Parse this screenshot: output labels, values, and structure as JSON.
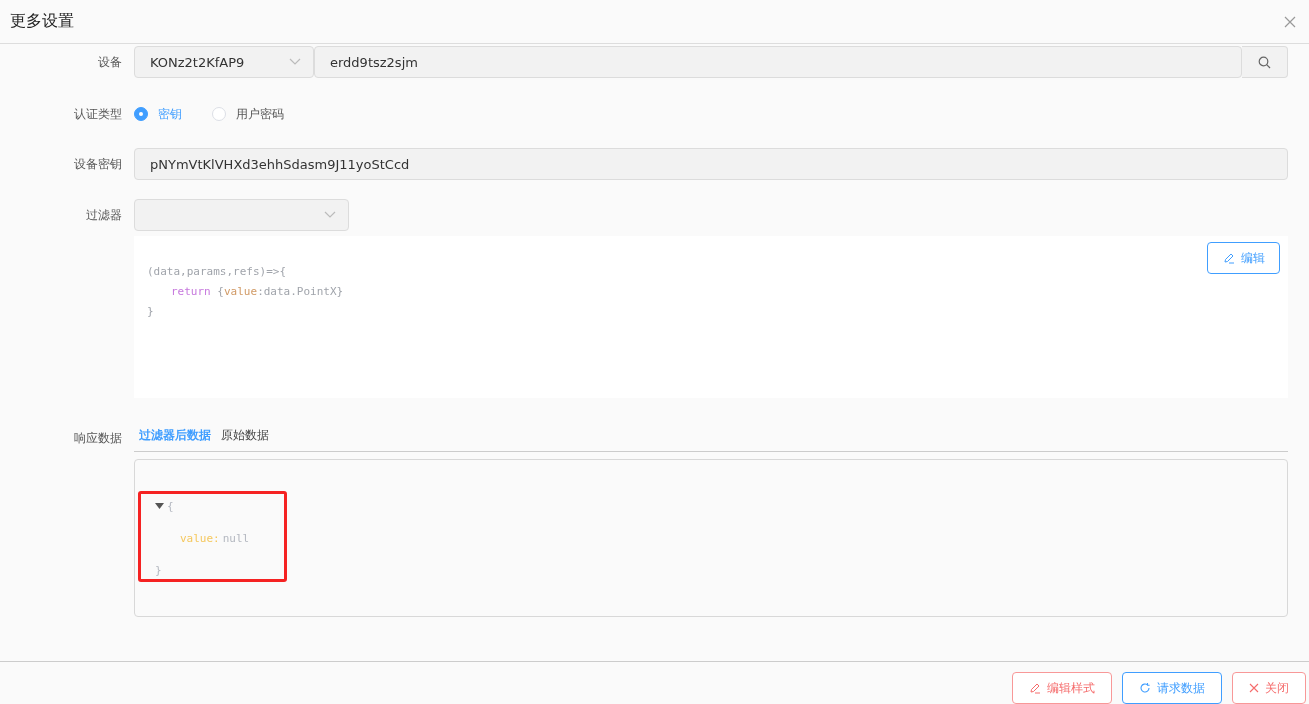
{
  "dialog": {
    "title": "更多设置"
  },
  "device": {
    "label": "设备",
    "product": "KONz2t2KfAP9",
    "device_name": "erdd9tsz2sjm"
  },
  "auth": {
    "label": "认证类型",
    "options": [
      {
        "label": "密钥",
        "selected": true
      },
      {
        "label": "用户密码",
        "selected": false
      }
    ]
  },
  "secret": {
    "label": "设备密钥",
    "value": "pNYmVtKlVHXd3ehhSdasm9J11yoStCcd"
  },
  "filter": {
    "label": "过滤器",
    "edit_button": "编辑",
    "code": [
      {
        "indented": false,
        "tokens": [
          {
            "kind": "plain",
            "text": "(data,params,refs)=>{"
          }
        ]
      },
      {
        "indented": true,
        "tokens": [
          {
            "kind": "keyword",
            "text": "return"
          },
          {
            "kind": "plain",
            "text": " {"
          },
          {
            "kind": "property",
            "text": "value"
          },
          {
            "kind": "plain",
            "text": ":data.PointX}"
          }
        ]
      },
      {
        "indented": false,
        "tokens": [
          {
            "kind": "plain",
            "text": "}"
          }
        ]
      }
    ]
  },
  "response": {
    "label": "响应数据",
    "tabs": [
      {
        "label": "过滤器后数据",
        "selected": true
      },
      {
        "label": "原始数据",
        "selected": false
      }
    ],
    "tree": {
      "expanded": true,
      "open": "{",
      "close": "}",
      "entries": [
        {
          "key": "value:",
          "value": "null"
        }
      ]
    }
  },
  "footer": {
    "buttons": [
      {
        "label": "编辑样式",
        "kind": "edit"
      },
      {
        "label": "请求数据",
        "kind": "request"
      },
      {
        "label": "关闭",
        "kind": "close"
      }
    ]
  }
}
